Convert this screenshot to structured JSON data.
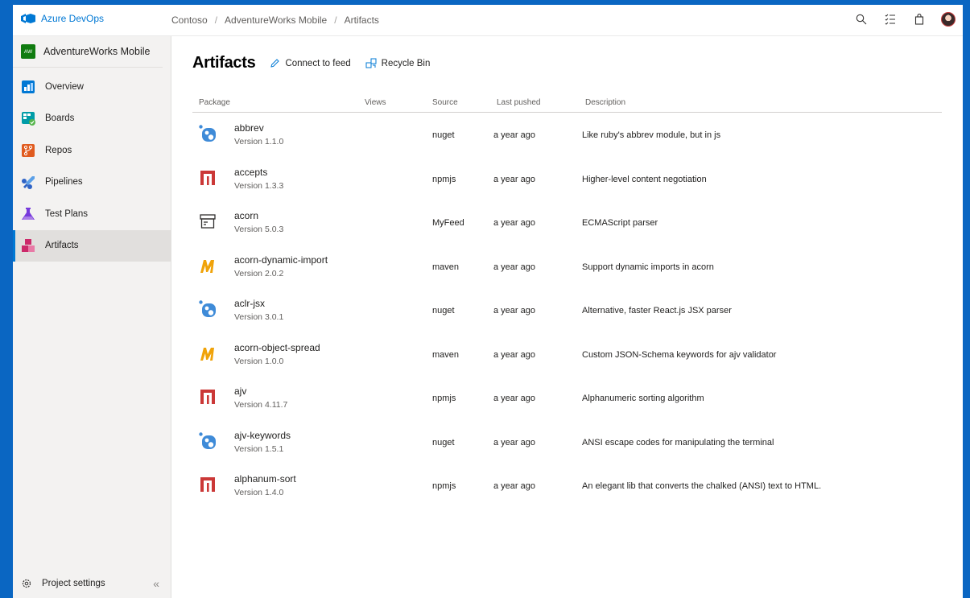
{
  "app": {
    "brand": "Azure DevOps"
  },
  "breadcrumb": [
    "Contoso",
    "AdventureWorks Mobile",
    "Artifacts"
  ],
  "project": {
    "badge": "AW",
    "name": "AdventureWorks Mobile"
  },
  "nav": [
    {
      "label": "Overview",
      "icon": "overview-icon",
      "color": "#0078d4"
    },
    {
      "label": "Boards",
      "icon": "boards-icon",
      "color": "#009ca7"
    },
    {
      "label": "Repos",
      "icon": "repos-icon",
      "color": "#e05b1f"
    },
    {
      "label": "Pipelines",
      "icon": "pipelines-icon",
      "color": "#2f64c6"
    },
    {
      "label": "Test Plans",
      "icon": "test-plans-icon",
      "color": "#773adc"
    },
    {
      "label": "Artifacts",
      "icon": "artifacts-icon",
      "color": "#cc2a6a",
      "active": true
    }
  ],
  "settings": {
    "label": "Project settings",
    "collapse": "«"
  },
  "page": {
    "title": "Artifacts",
    "connect_label": "Connect to feed",
    "recycle_label": "Recycle Bin"
  },
  "table": {
    "headers": {
      "package": "Package",
      "views": "Views",
      "source": "Source",
      "last_pushed": "Last pushed",
      "description": "Description"
    },
    "rows": [
      {
        "name": "abbrev",
        "version": "Version 1.1.0",
        "source": "nuget",
        "pushed": "a year ago",
        "description": "Like ruby's abbrev module, but in js",
        "type": "nuget"
      },
      {
        "name": "accepts",
        "version": "Version 1.3.3",
        "source": "npmjs",
        "pushed": "a year ago",
        "description": "Higher-level content negotiation",
        "type": "npm"
      },
      {
        "name": "acorn",
        "version": "Version 5.0.3",
        "source": "MyFeed",
        "pushed": "a year ago",
        "description": "ECMAScript parser",
        "type": "generic"
      },
      {
        "name": "acorn-dynamic-import",
        "version": "Version 2.0.2",
        "source": "maven",
        "pushed": "a year ago",
        "description": "Support dynamic imports in acorn",
        "type": "maven"
      },
      {
        "name": "aclr-jsx",
        "version": "Version 3.0.1",
        "source": "nuget",
        "pushed": "a year ago",
        "description": "Alternative, faster React.js JSX parser",
        "type": "nuget"
      },
      {
        "name": "acorn-object-spread",
        "version": "Version 1.0.0",
        "source": "maven",
        "pushed": "a year ago",
        "description": "Custom JSON-Schema keywords for ajv validator",
        "type": "maven"
      },
      {
        "name": "ajv",
        "version": "Version 4.11.7",
        "source": "npmjs",
        "pushed": "a year ago",
        "description": "Alphanumeric sorting algorithm",
        "type": "npm"
      },
      {
        "name": "ajv-keywords",
        "version": "Version 1.5.1",
        "source": "nuget",
        "pushed": "a year ago",
        "description": "ANSI escape codes for manipulating the terminal",
        "type": "nuget"
      },
      {
        "name": "alphanum-sort",
        "version": "Version 1.4.0",
        "source": "npmjs",
        "pushed": "a year ago",
        "description": "An elegant lib that converts the chalked (ANSI) text to HTML.",
        "type": "npm"
      }
    ]
  },
  "colors": {
    "accent": "#0078d4",
    "frame": "#0a66c2",
    "nuget": "#3f8bd8",
    "npm": "#cb3837",
    "maven": "#f0a30a"
  }
}
